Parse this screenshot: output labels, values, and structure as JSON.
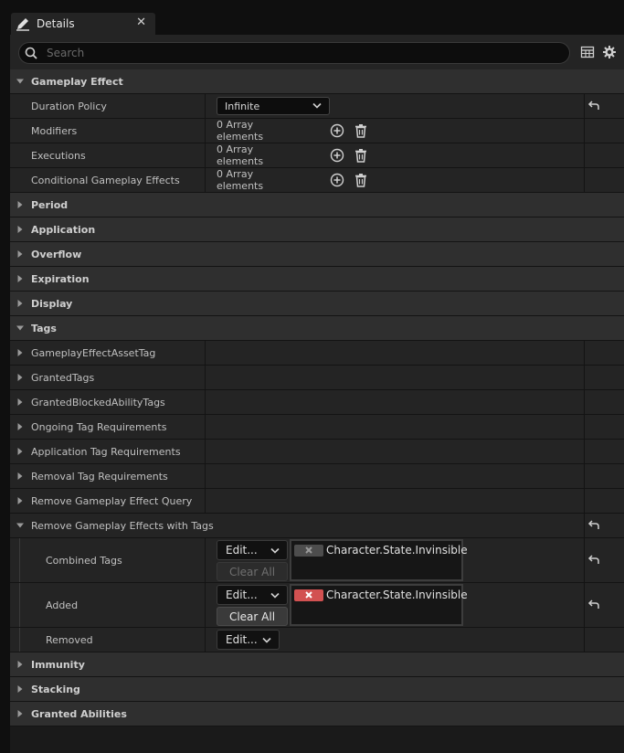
{
  "window": {
    "tab_title": "Details"
  },
  "search": {
    "placeholder": "Search"
  },
  "sections": {
    "gameplay_effect": "Gameplay Effect",
    "period": "Period",
    "application": "Application",
    "overflow": "Overflow",
    "expiration": "Expiration",
    "display": "Display",
    "tags": "Tags",
    "immunity": "Immunity",
    "stacking": "Stacking",
    "granted_abilities": "Granted Abilities"
  },
  "gameplay_effect": {
    "duration_policy": {
      "label": "Duration Policy",
      "value": "Infinite"
    },
    "modifiers": {
      "label": "Modifiers",
      "value": "0 Array elements"
    },
    "executions": {
      "label": "Executions",
      "value": "0 Array elements"
    },
    "conditional": {
      "label": "Conditional Gameplay Effects",
      "value": "0 Array elements"
    }
  },
  "tags": {
    "asset_tag": "GameplayEffectAssetTag",
    "granted_tags": "GrantedTags",
    "granted_blocked": "GrantedBlockedAbilityTags",
    "ongoing": "Ongoing Tag Requirements",
    "application_req": "Application Tag Requirements",
    "removal_req": "Removal Tag Requirements",
    "remove_query": "Remove Gameplay Effect Query",
    "remove_with_tags": "Remove Gameplay Effects with Tags"
  },
  "remove_with_tags": {
    "combined": {
      "label": "Combined Tags",
      "edit": "Edit...",
      "clear": "Clear All",
      "tag": "Character.State.Invinsible"
    },
    "added": {
      "label": "Added",
      "edit": "Edit...",
      "clear": "Clear All",
      "tag": "Character.State.Invinsible"
    },
    "removed": {
      "label": "Removed",
      "edit": "Edit..."
    }
  },
  "colors": {
    "accent_red": "#d25151",
    "panel_bg": "#242424",
    "category_bg": "#2f2f2f"
  }
}
